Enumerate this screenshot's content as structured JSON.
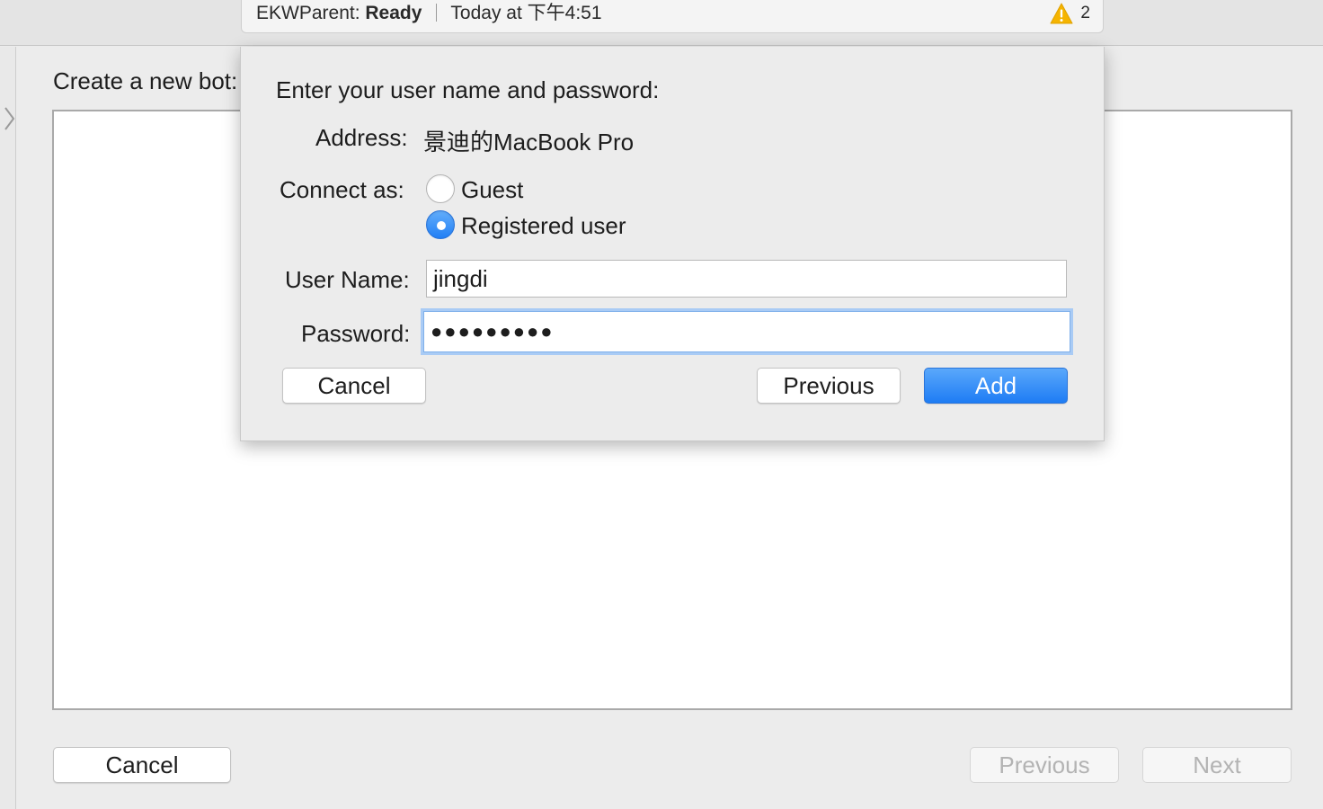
{
  "toolbar": {
    "app_name": "EKWParent:",
    "state": "Ready",
    "timestamp": "Today at 下午4:51",
    "warning_count": "2",
    "warning_color": "#f5b400"
  },
  "background_window": {
    "title": "Create a new bot:",
    "cancel_label": "Cancel",
    "previous_label": "Previous",
    "next_label": "Next"
  },
  "dialog": {
    "prompt": "Enter your user name and password:",
    "address_label": "Address:",
    "address_value": "景迪的MacBook Pro",
    "connect_as_label": "Connect as:",
    "connect_options": [
      {
        "label": "Guest",
        "selected": false
      },
      {
        "label": "Registered user",
        "selected": true
      }
    ],
    "username_label": "User Name:",
    "username_value": "jingdi",
    "password_label": "Password:",
    "password_mask": "●●●●●●●●●",
    "cancel_label": "Cancel",
    "previous_label": "Previous",
    "add_label": "Add",
    "accent_color": "#1e7cf4"
  }
}
